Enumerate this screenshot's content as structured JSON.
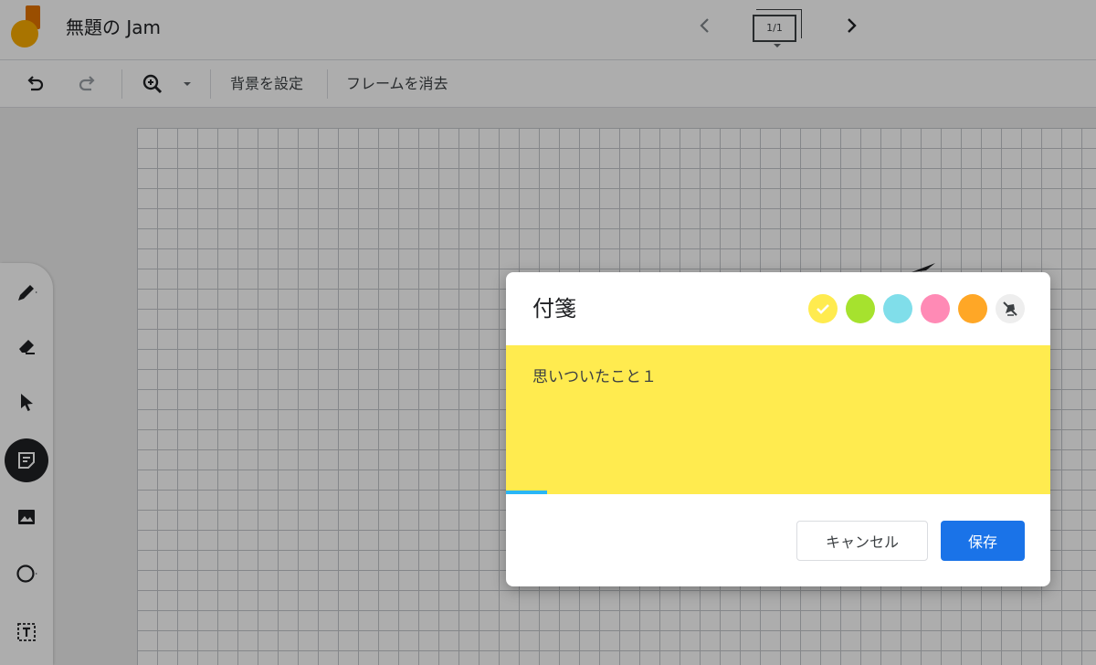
{
  "app": {
    "doc_title": "無題の Jam",
    "frame_counter": "1/1"
  },
  "toolbar": {
    "undo_icon": "undo-icon",
    "redo_icon": "redo-icon",
    "zoom_icon": "zoom-in-icon",
    "set_background_label": "背景を設定",
    "clear_frame_label": "フレームを消去"
  },
  "tools": [
    {
      "name": "pen",
      "icon": "pen-icon"
    },
    {
      "name": "eraser",
      "icon": "eraser-icon"
    },
    {
      "name": "select",
      "icon": "pointer-icon"
    },
    {
      "name": "sticky-note",
      "icon": "sticky-note-icon",
      "active": true
    },
    {
      "name": "image",
      "icon": "image-icon"
    },
    {
      "name": "shape",
      "icon": "circle-icon"
    },
    {
      "name": "text",
      "icon": "text-box-icon"
    }
  ],
  "dialog": {
    "title": "付箋",
    "note_text": "思いついたこと１",
    "note_color": "#ffeb4f",
    "swatches": [
      {
        "name": "yellow",
        "color": "#ffeb4f",
        "selected": true
      },
      {
        "name": "green",
        "color": "#a6e22e"
      },
      {
        "name": "cyan",
        "color": "#80deea"
      },
      {
        "name": "pink",
        "color": "#ff8ab5"
      },
      {
        "name": "orange",
        "color": "#ffa726"
      },
      {
        "name": "none",
        "color": "#eeeeee",
        "icon": "no-color-icon"
      }
    ],
    "progress": 0.075,
    "cancel_label": "キャンセル",
    "save_label": "保存"
  },
  "colors": {
    "accent": "#1a73e8",
    "progress": "#29b6f6",
    "active_tool": "#202124"
  }
}
